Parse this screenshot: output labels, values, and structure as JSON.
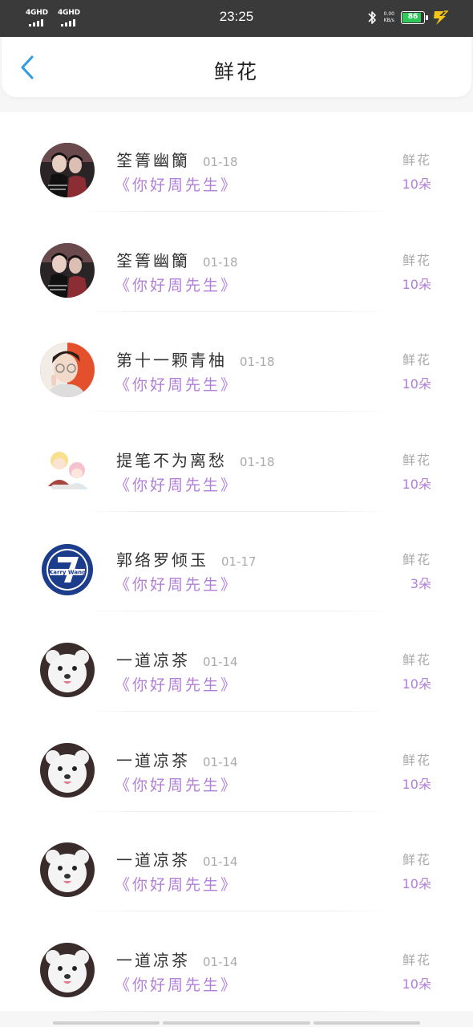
{
  "status_bar": {
    "network_1": "4GHD",
    "network_2": "4GHD",
    "time": "23:25",
    "net_speed_value": "0.00",
    "net_speed_unit": "KB/s",
    "battery_level": "86",
    "bluetooth_icon": "bluetooth-icon",
    "charging_icon": "charging-bolt-icon"
  },
  "header": {
    "title": "鲜花",
    "back_icon": "chevron-left-icon"
  },
  "colors": {
    "accent": "#b17fd8",
    "back_arrow": "#2d9be6",
    "battery_fill": "#2ec95a"
  },
  "gifts": [
    {
      "user": "筌箐幽籣",
      "date": "01-18",
      "book": "《你好周先生》",
      "gift_type": "鲜花",
      "gift_count": "10朵",
      "avatar": "couple-photo"
    },
    {
      "user": "筌箐幽籣",
      "date": "01-18",
      "book": "《你好周先生》",
      "gift_type": "鲜花",
      "gift_count": "10朵",
      "avatar": "couple-photo"
    },
    {
      "user": "第十一颗青柚",
      "date": "01-18",
      "book": "《你好周先生》",
      "gift_type": "鲜花",
      "gift_count": "10朵",
      "avatar": "portrait-glasses"
    },
    {
      "user": "提笔不为离愁",
      "date": "01-18",
      "book": "《你好周先生》",
      "gift_type": "鲜花",
      "gift_count": "10朵",
      "avatar": "cartoon-pair"
    },
    {
      "user": "郭络罗倾玉",
      "date": "01-17",
      "book": "《你好周先生》",
      "gift_type": "鲜花",
      "gift_count": "3朵",
      "avatar": "karry-wang-7-badge"
    },
    {
      "user": "一道凉茶",
      "date": "01-14",
      "book": "《你好周先生》",
      "gift_type": "鲜花",
      "gift_count": "10朵",
      "avatar": "white-puppy"
    },
    {
      "user": "一道凉茶",
      "date": "01-14",
      "book": "《你好周先生》",
      "gift_type": "鲜花",
      "gift_count": "10朵",
      "avatar": "white-puppy"
    },
    {
      "user": "一道凉茶",
      "date": "01-14",
      "book": "《你好周先生》",
      "gift_type": "鲜花",
      "gift_count": "10朵",
      "avatar": "white-puppy"
    },
    {
      "user": "一道凉茶",
      "date": "01-14",
      "book": "《你好周先生》",
      "gift_type": "鲜花",
      "gift_count": "10朵",
      "avatar": "white-puppy"
    }
  ]
}
